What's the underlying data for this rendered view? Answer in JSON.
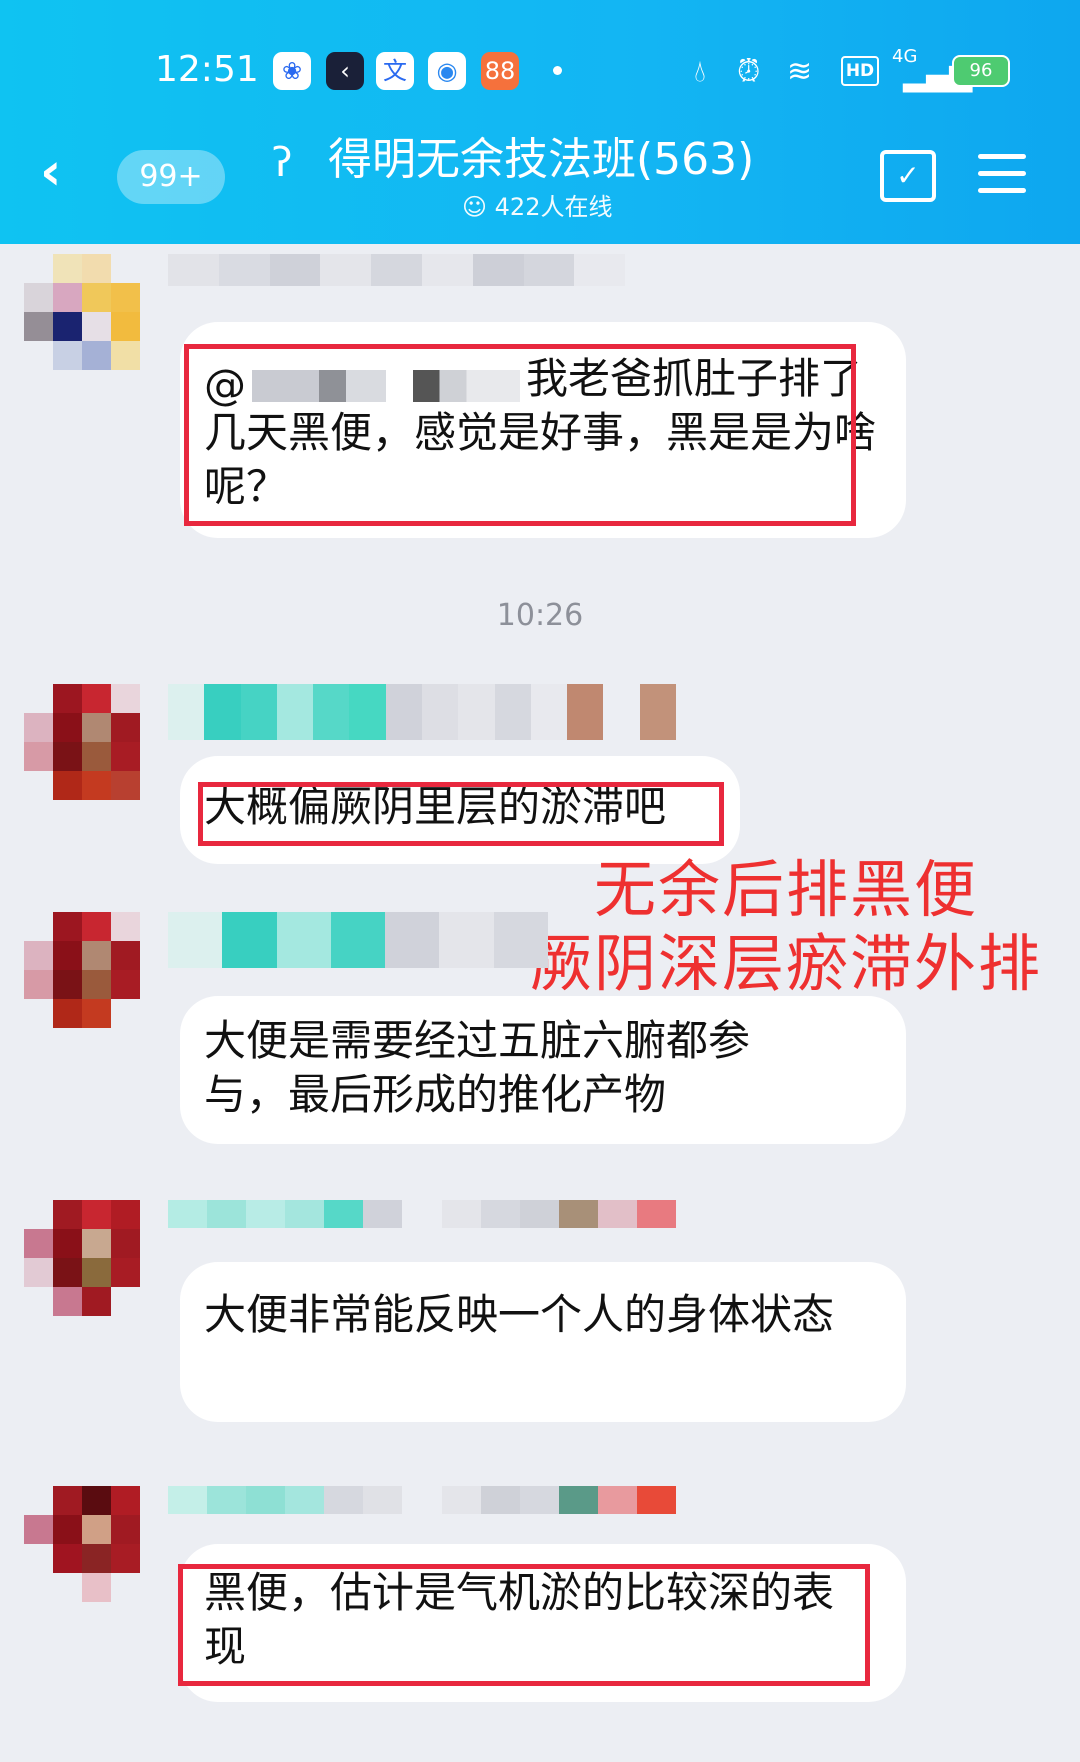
{
  "status_bar": {
    "time": "12:51",
    "signal": "4G",
    "hd": "HD",
    "battery": "96"
  },
  "header": {
    "back_icon": "chevron-left",
    "unread_badge": "99+",
    "title": "得明无余技法班(563)",
    "online": "422人在线"
  },
  "timestamp": "10:26",
  "messages": [
    {
      "mention": "@",
      "text": "我老爸抓肚子排了几天黑便，感觉是好事，黑是是为啥呢？"
    },
    {
      "text": "大概偏厥阴里层的淤滞吧"
    },
    {
      "text": "大便是需要经过五脏六腑都参与，最后形成的推化产物"
    },
    {
      "text": "大便非常能反映一个人的身体状态"
    },
    {
      "text": "黑便，估计是气机淤的比较深的表现"
    }
  ],
  "annotation": {
    "line1": "无余后排黑便",
    "line2": "厥阴深层瘀滞外排",
    "color": "#ee3030"
  },
  "colors": {
    "header": "#13b5f3",
    "background": "#eceef3",
    "highlight_box": "#e8283e"
  }
}
